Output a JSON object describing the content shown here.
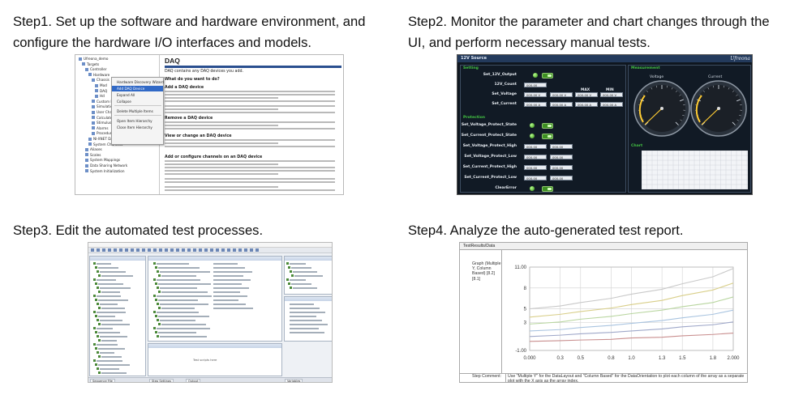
{
  "steps": [
    {
      "caption_line1": "Step1. Set up the software and hardware environment, and",
      "caption_line2": "configure the hardware I/O interfaces and models."
    },
    {
      "caption_line1": "Step2. Monitor the parameter and chart changes through the",
      "caption_line2": "UI, and perform necessary manual tests."
    },
    {
      "caption_line1": "Step3. Edit the automated test processes."
    },
    {
      "caption_line1": "Step4. Analyze the auto-generated test report."
    }
  ],
  "step1": {
    "tree": [
      "Ufreona_demo",
      "Targets",
      "Controller",
      "Hardware",
      "Chassis",
      "Mod",
      "DAQ",
      "Hd",
      "Custom Devices",
      "Simulation M",
      "User Channels",
      "Calculated",
      "Stimulus",
      "Alarms",
      "Procedures",
      "NI-XNET Databases",
      "System Channels",
      "Aliases",
      "Scales",
      "System Mappings",
      "Data Sharing Network",
      "System Initialization"
    ],
    "menu": [
      "Hardware Discovery Wizard",
      "Add DAQ Device",
      "Expand All",
      "Collapse",
      "Delete Multiple Items",
      "Open Item Hierarchy",
      "Close Item Hierarchy"
    ],
    "doc_title": "DAQ",
    "doc_subtitle": "DAQ contains any DAQ devices you add.",
    "headings": [
      "What do you want to do?",
      "Add a DAQ device",
      "Remove a DAQ device",
      "View or change an DAQ device",
      "Add or configure channels on an DAQ device"
    ]
  },
  "step2": {
    "title": "12V Source",
    "logo": "Ufreona",
    "setting_label": "Setting",
    "measurement_label": "Measurement",
    "protection_label": "Protection",
    "chart_label": "Chart",
    "voltage_gauge_title": "Voltage",
    "current_gauge_title": "Current",
    "max_label": "MAX",
    "min_label": "MIN",
    "rows": [
      {
        "label": "Set_12V_Output"
      },
      {
        "label": "12V_Count",
        "value": "000.00"
      },
      {
        "label": "Set_Voltage",
        "value": "000.00 V",
        "max": "000.00 V",
        "min": "000.00 V",
        "extra": "000.00 V"
      },
      {
        "label": "Set_Current",
        "value": "000.00 A",
        "max": "000.00 A",
        "min": "000.00 A",
        "extra": "000.00 A"
      }
    ],
    "protect_rows": [
      {
        "label": "Set_Voltage_Protect_State"
      },
      {
        "label": "Set_Current_Protect_State"
      },
      {
        "label": "Set_Voltage_Protect_High",
        "value": "000.00",
        "value2": "000.00"
      },
      {
        "label": "Set_Voltage_Protect_Low",
        "value": "000.00",
        "value2": "000.00"
      },
      {
        "label": "Set_Current_Protect_High",
        "value": "000.00",
        "value2": "000.00"
      },
      {
        "label": "Set_Current_Protect_Low",
        "value": "000.00",
        "value2": "000.00"
      },
      {
        "label": "ClearError"
      }
    ],
    "colors": {
      "led": "#43c343",
      "background": "#0f161f",
      "titlebar": "#233a5c"
    }
  },
  "step3": {
    "tabs": [
      "Sequence File",
      "Step Settings",
      "Output",
      "Variables"
    ],
    "status_text": "Test scripts here"
  },
  "step4": {
    "header": "TestResults/Data",
    "graph_label": "Graph (Multiple Y, Column Based) [8.2] [8.1]",
    "step_comment_label": "Step Comment:",
    "step_comment": "Use \"Multiple Y\" for the DataLayout and \"Column Based\" for the DataOrientation to plot each column of the array as a separate plot with the X axis as the array index."
  },
  "chart_data": {
    "type": "line",
    "title": "",
    "xlabel": "",
    "ylabel": "",
    "x": [
      0.0,
      0.3,
      0.5,
      0.8,
      1.0,
      1.3,
      1.5,
      1.8,
      2.0
    ],
    "x_tick_labels": [
      "0.000",
      "0.3",
      "0.5",
      "0.8",
      "1.0",
      "1.3",
      "1.5",
      "1.8",
      "2.000"
    ],
    "y_tick_labels": [
      "11.00",
      "8",
      "5",
      "3",
      "-1.00"
    ],
    "y_tick_values": [
      11,
      8,
      5,
      3,
      -1
    ],
    "xlim": [
      0,
      2
    ],
    "ylim": [
      -1,
      11
    ],
    "grid": true,
    "series": [
      {
        "color": "#c9c9c9",
        "values": [
          5.0,
          5.4,
          5.9,
          6.5,
          7.1,
          7.8,
          8.6,
          9.6,
          10.8
        ]
      },
      {
        "color": "#d9cf8a",
        "values": [
          3.8,
          4.2,
          4.6,
          5.1,
          5.6,
          6.2,
          6.9,
          7.7,
          8.7
        ]
      },
      {
        "color": "#b9d6a0",
        "values": [
          2.8,
          3.1,
          3.5,
          3.9,
          4.3,
          4.8,
          5.3,
          5.9,
          6.7
        ]
      },
      {
        "color": "#a9c4e0",
        "values": [
          1.8,
          2.0,
          2.3,
          2.6,
          2.9,
          3.3,
          3.7,
          4.2,
          4.8
        ]
      },
      {
        "color": "#9fa8c9",
        "values": [
          1.0,
          1.2,
          1.4,
          1.6,
          1.8,
          2.1,
          2.4,
          2.7,
          3.1
        ]
      },
      {
        "color": "#c98f8f",
        "values": [
          0.3,
          0.4,
          0.5,
          0.6,
          0.8,
          0.9,
          1.1,
          1.3,
          1.5
        ]
      }
    ]
  }
}
